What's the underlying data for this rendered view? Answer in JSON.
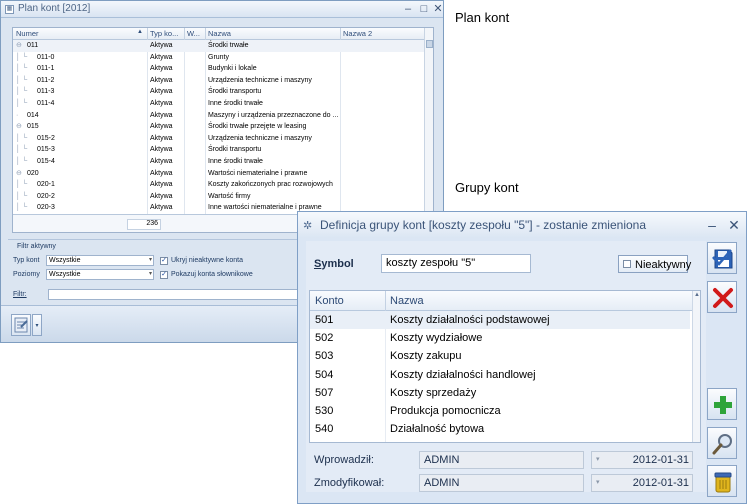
{
  "captions": {
    "plan_kont": "Plan kont",
    "grupy_kont": "Grupy kont"
  },
  "plan_window": {
    "title": "Plan kont [2012]",
    "columns": [
      "Numer",
      "Typ ko...",
      "W...",
      "Nazwa",
      "Nazwa 2"
    ],
    "rows": [
      {
        "numer": "011",
        "typ": "Aktywa",
        "nazwa": "Środki trwałe",
        "level": 0,
        "expander": "⊖"
      },
      {
        "numer": "011-0",
        "typ": "Aktywa",
        "nazwa": "Grunty",
        "level": 1
      },
      {
        "numer": "011-1",
        "typ": "Aktywa",
        "nazwa": "Budynki i lokale",
        "level": 1
      },
      {
        "numer": "011-2",
        "typ": "Aktywa",
        "nazwa": "Urządzenia techniczne i maszyny",
        "level": 1
      },
      {
        "numer": "011-3",
        "typ": "Aktywa",
        "nazwa": "Środki transportu",
        "level": 1
      },
      {
        "numer": "011-4",
        "typ": "Aktywa",
        "nazwa": "Inne środki trwałe",
        "level": 1
      },
      {
        "numer": "014",
        "typ": "Aktywa",
        "nazwa": "Maszyny i urządzenia przeznaczone do ...",
        "level": 0
      },
      {
        "numer": "015",
        "typ": "Aktywa",
        "nazwa": "Środki trwałe przejęte w leasing",
        "level": 0,
        "expander": "⊖"
      },
      {
        "numer": "015-2",
        "typ": "Aktywa",
        "nazwa": "Urządzenia techniczne i maszyny",
        "level": 1
      },
      {
        "numer": "015-3",
        "typ": "Aktywa",
        "nazwa": "Środki transportu",
        "level": 1
      },
      {
        "numer": "015-4",
        "typ": "Aktywa",
        "nazwa": "Inne środki trwałe",
        "level": 1
      },
      {
        "numer": "020",
        "typ": "Aktywa",
        "nazwa": "Wartości niematerialne i prawne",
        "level": 0,
        "expander": "⊖"
      },
      {
        "numer": "020-1",
        "typ": "Aktywa",
        "nazwa": "Koszty zakończonych prac rozwojowych",
        "level": 1
      },
      {
        "numer": "020-2",
        "typ": "Aktywa",
        "nazwa": "Wartość firmy",
        "level": 1
      },
      {
        "numer": "020-3",
        "typ": "Aktywa",
        "nazwa": "Inne wartości niematerialne i prawne",
        "level": 1
      }
    ],
    "count": "236",
    "filter": {
      "group_label": "Filtr aktywny",
      "typ_label": "Typ kont",
      "typ_value": "Wszystkie",
      "poziomy_label": "Poziomy",
      "poziomy_value": "Wszystkie",
      "chk1_label": "Ukryj nieaktywne konta",
      "chk2_label": "Pokazuj konta słownikowe",
      "filtr_label": "Filtr:"
    }
  },
  "group_window": {
    "title": "Definicja grupy kont [koszty zespołu \"5\"] - zostanie zmieniona",
    "symbol_label": "Symbol",
    "symbol_value": "koszty zespołu \"5\"",
    "nieaktywny_label": "Nieaktywny",
    "columns": [
      "Konto",
      "Nazwa"
    ],
    "rows": [
      {
        "konto": "501",
        "nazwa": "Koszty działalności podstawowej"
      },
      {
        "konto": "502",
        "nazwa": "Koszty wydziałowe"
      },
      {
        "konto": "503",
        "nazwa": "Koszty zakupu"
      },
      {
        "konto": "504",
        "nazwa": "Koszty działalności handlowej"
      },
      {
        "konto": "507",
        "nazwa": "Koszty sprzedaży"
      },
      {
        "konto": "530",
        "nazwa": "Produkcja pomocnicza"
      },
      {
        "konto": "540",
        "nazwa": "Działalność bytowa"
      }
    ],
    "wprowadzil_label": "Wprowadził:",
    "wprowadzil_user": "ADMIN",
    "wprowadzil_date": "2012-01-31",
    "zmodyfikowal_label": "Zmodyfikował:",
    "zmodyfikowal_user": "ADMIN",
    "zmodyfikowal_date": "2012-01-31"
  },
  "colors": {
    "save_icon": "#2c63b8",
    "cancel_icon": "#d11a1a",
    "add_icon": "#2ea43a",
    "trash_icon": "#e0b51d"
  }
}
